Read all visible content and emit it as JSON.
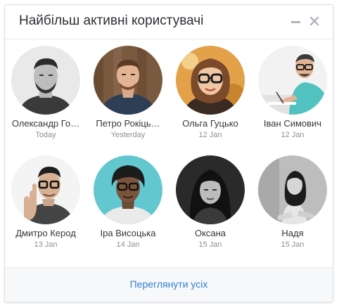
{
  "widget": {
    "title": "Найбільш активні користувачі",
    "minimize_icon": "minus-icon",
    "close_icon": "close-icon"
  },
  "users": [
    {
      "name": "Олександр Го…",
      "date": "Today",
      "photo": "grayscale-man-beard"
    },
    {
      "name": "Петро Рокіць…",
      "date": "Yesterday",
      "photo": "man-wood-background"
    },
    {
      "name": "Ольга Гуцько",
      "date": "12 Jan",
      "photo": "woman-glasses-orange"
    },
    {
      "name": "Іван Симович",
      "date": "12 Jan",
      "photo": "man-drawing-desk"
    },
    {
      "name": "Дмитро Керод",
      "date": "13 Jan",
      "photo": "man-pointing-finger"
    },
    {
      "name": "Іра Висоцька",
      "date": "14 Jan",
      "photo": "woman-teal-background"
    },
    {
      "name": "Оксана",
      "date": "15 Jan",
      "photo": "grayscale-woman-bangs"
    },
    {
      "name": "Надя",
      "date": "15 Jan",
      "photo": "grayscale-woman-sitting"
    }
  ],
  "footer": {
    "view_all_label": "Переглянути усіх"
  },
  "colors": {
    "link": "#2d7fd3",
    "title": "#2b2f33",
    "muted": "#8a9096"
  }
}
